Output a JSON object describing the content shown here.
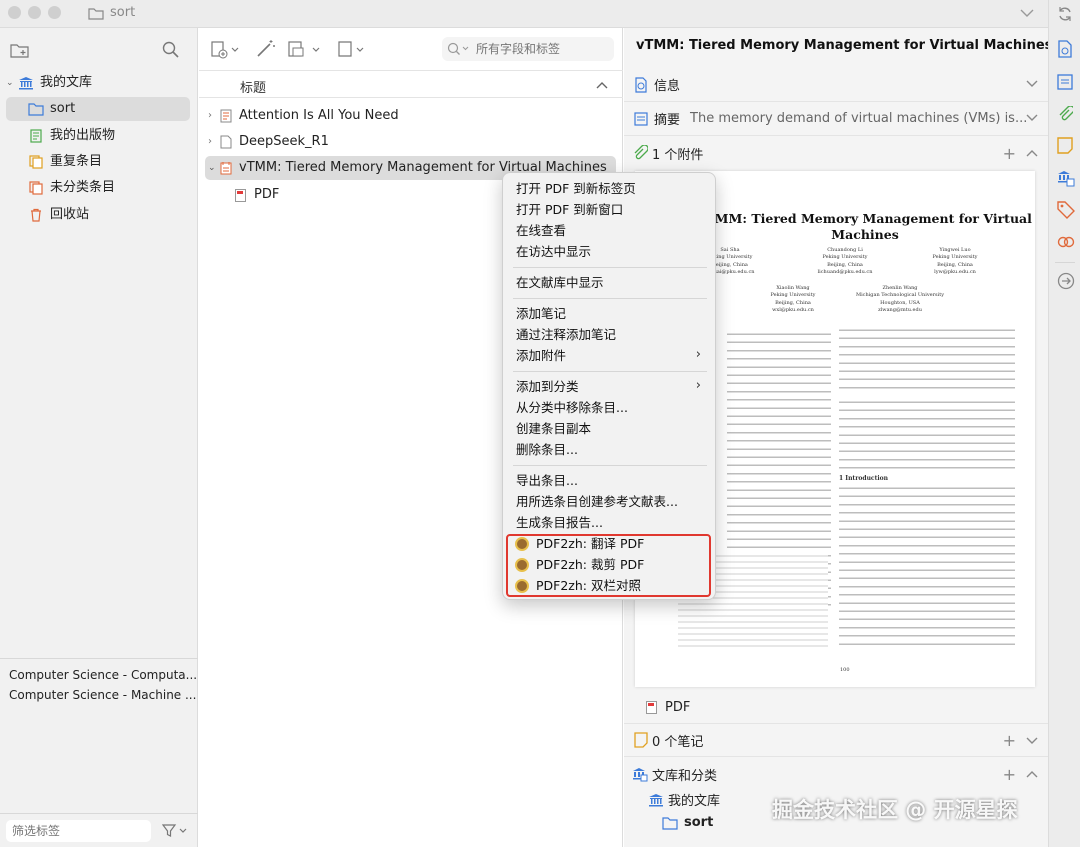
{
  "window": {
    "folder_name": "sort"
  },
  "left_sidebar": {
    "library_label": "我的文库",
    "items": [
      {
        "label": "sort"
      },
      {
        "label": "我的出版物"
      },
      {
        "label": "重复条目"
      },
      {
        "label": "未分类条目"
      },
      {
        "label": "回收站"
      }
    ],
    "tags": [
      "Computer Science - Computa...",
      "Computer Science - Machine ..."
    ],
    "tag_filter_placeholder": "筛选标签"
  },
  "middle": {
    "search_placeholder": "所有字段和标签",
    "column_header": "标题",
    "items": [
      {
        "title": "Attention Is All You Need"
      },
      {
        "title": "DeepSeek_R1"
      },
      {
        "title": "vTMM: Tiered Memory Management for Virtual Machines"
      }
    ],
    "child_item": "PDF"
  },
  "context_menu": {
    "group1": [
      "打开 PDF 到新标签页",
      "打开 PDF 到新窗口",
      "在线查看",
      "在访达中显示"
    ],
    "group2": [
      "在文献库中显示"
    ],
    "group3": [
      "添加笔记",
      "通过注释添加笔记",
      "添加附件"
    ],
    "group4": [
      "添加到分类",
      "从分类中移除条目...",
      "创建条目副本",
      "删除条目..."
    ],
    "group5": [
      "导出条目...",
      "用所选条目创建参考文献表...",
      "生成条目报告..."
    ],
    "plugin": [
      "PDF2zh: 翻译 PDF",
      "PDF2zh: 裁剪 PDF",
      "PDF2zh: 双栏对照"
    ]
  },
  "right_pane": {
    "title": "vTMM: Tiered Memory Management for Virtual Machines",
    "info_label": "信息",
    "abstract_label": "摘要",
    "abstract_text": "The memory demand of virtual machines (VMs) is...",
    "attachments_label": "1 个附件",
    "attachment_name": "PDF",
    "notes_label": "0 个笔记",
    "libraries_label": "文库和分类",
    "library_name": "我的文库",
    "collection_name": "sort"
  },
  "pdf_preview": {
    "title": "vTMM: Tiered Memory Management for Virtual Machines",
    "authors": [
      {
        "name": "Sai Sha",
        "affil": "Peking University",
        "city": "Beijing, China",
        "email": "shasai@pku.edu.cn"
      },
      {
        "name": "Chuandong Li",
        "affil": "Peking University",
        "city": "Beijing, China",
        "email": "lichuand@pku.edu.cn"
      },
      {
        "name": "Yingwei Luo",
        "affil": "Peking University",
        "city": "Beijing, China",
        "email": "lyw@pku.edu.cn"
      },
      {
        "name": "Xiaolin Wang",
        "affil": "Peking University",
        "city": "Beijing, China",
        "email": "wxl@pku.edu.cn"
      },
      {
        "name": "Zhenlin Wang",
        "affil": "Michigan Technological University",
        "city": "Houghton, USA",
        "email": "zlwang@mtu.edu"
      }
    ],
    "section_heading": "1 Introduction",
    "page_number": "100"
  },
  "watermark": "掘金技术社区 @ 开源星探",
  "colors": {
    "accent": "#3d7bd9",
    "highlight_border": "#e0382f",
    "selection": "#dcdcdc"
  }
}
